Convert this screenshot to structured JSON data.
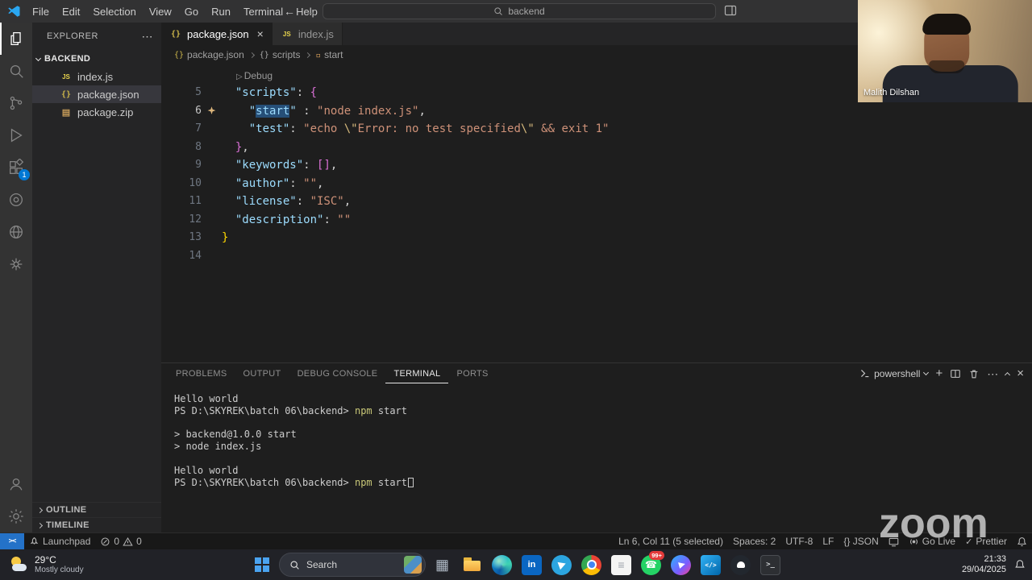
{
  "title_bar": {
    "menus": [
      "File",
      "Edit",
      "Selection",
      "View",
      "Go",
      "Run",
      "Terminal",
      "Help"
    ],
    "search_value": "backend"
  },
  "activity_bar": {
    "extensions_badge": "1"
  },
  "explorer": {
    "title": "EXPLORER",
    "folder": "BACKEND",
    "files": [
      {
        "name": "index.js",
        "icon": "js",
        "active": false
      },
      {
        "name": "package.json",
        "icon": "json",
        "active": true
      },
      {
        "name": "package.zip",
        "icon": "zip",
        "active": false
      }
    ],
    "bottom_sections": [
      "OUTLINE",
      "TIMELINE"
    ]
  },
  "editor": {
    "tabs": [
      {
        "label": "package.json",
        "icon": "json",
        "active": true
      },
      {
        "label": "index.js",
        "icon": "js",
        "active": false
      }
    ],
    "breadcrumb": [
      {
        "label": "package.json"
      },
      {
        "label": "scripts"
      },
      {
        "label": "start"
      }
    ],
    "codelens": "Debug",
    "lines": [
      {
        "num": "5",
        "tokens": [
          {
            "c": "p",
            "t": "  "
          },
          {
            "c": "k",
            "t": "\"scripts\""
          },
          {
            "c": "p",
            "t": ": "
          },
          {
            "c": "b2",
            "t": "{"
          }
        ]
      },
      {
        "num": "6",
        "active": true,
        "sparkle": true,
        "tokens": [
          {
            "c": "p",
            "t": "    "
          },
          {
            "c": "k",
            "t": "\""
          },
          {
            "c": "k sel",
            "t": "start"
          },
          {
            "c": "k",
            "t": "\""
          },
          {
            "c": "p",
            "t": " : "
          },
          {
            "c": "s",
            "t": "\"node index.js\""
          },
          {
            "c": "p",
            "t": ","
          }
        ]
      },
      {
        "num": "7",
        "tokens": [
          {
            "c": "p",
            "t": "    "
          },
          {
            "c": "k",
            "t": "\"test\""
          },
          {
            "c": "p",
            "t": ": "
          },
          {
            "c": "s",
            "t": "\"echo "
          },
          {
            "c": "e",
            "t": "\\\""
          },
          {
            "c": "s",
            "t": "Error: no test specified"
          },
          {
            "c": "e",
            "t": "\\\""
          },
          {
            "c": "s",
            "t": " && exit 1\""
          }
        ]
      },
      {
        "num": "8",
        "tokens": [
          {
            "c": "p",
            "t": "  "
          },
          {
            "c": "b2",
            "t": "}"
          },
          {
            "c": "p",
            "t": ","
          }
        ]
      },
      {
        "num": "9",
        "tokens": [
          {
            "c": "p",
            "t": "  "
          },
          {
            "c": "k",
            "t": "\"keywords\""
          },
          {
            "c": "p",
            "t": ": "
          },
          {
            "c": "b2",
            "t": "[]"
          },
          {
            "c": "p",
            "t": ","
          }
        ]
      },
      {
        "num": "10",
        "tokens": [
          {
            "c": "p",
            "t": "  "
          },
          {
            "c": "k",
            "t": "\"author\""
          },
          {
            "c": "p",
            "t": ": "
          },
          {
            "c": "s",
            "t": "\"\""
          },
          {
            "c": "p",
            "t": ","
          }
        ]
      },
      {
        "num": "11",
        "tokens": [
          {
            "c": "p",
            "t": "  "
          },
          {
            "c": "k",
            "t": "\"license\""
          },
          {
            "c": "p",
            "t": ": "
          },
          {
            "c": "s",
            "t": "\"ISC\""
          },
          {
            "c": "p",
            "t": ","
          }
        ]
      },
      {
        "num": "12",
        "tokens": [
          {
            "c": "p",
            "t": "  "
          },
          {
            "c": "k",
            "t": "\"description\""
          },
          {
            "c": "p",
            "t": ": "
          },
          {
            "c": "s",
            "t": "\"\""
          }
        ]
      },
      {
        "num": "13",
        "tokens": [
          {
            "c": "b1",
            "t": "}"
          }
        ]
      },
      {
        "num": "14",
        "tokens": []
      }
    ]
  },
  "panel": {
    "tabs": [
      "PROBLEMS",
      "OUTPUT",
      "DEBUG CONSOLE",
      "TERMINAL",
      "PORTS"
    ],
    "active_tab": "TERMINAL",
    "shell_label": "powershell",
    "terminal_lines": [
      [
        {
          "c": "d",
          "t": "Hello world"
        }
      ],
      [
        {
          "c": "d",
          "t": "PS D:\\SKYREK\\batch 06\\backend> "
        },
        {
          "c": "y",
          "t": "npm"
        },
        {
          "c": "d",
          "t": " start"
        }
      ],
      [],
      [
        {
          "c": "d",
          "t": "> backend@1.0.0 start"
        }
      ],
      [
        {
          "c": "d",
          "t": "> node index.js"
        }
      ],
      [],
      [
        {
          "c": "d",
          "t": "Hello world"
        }
      ],
      [
        {
          "c": "d",
          "t": "PS D:\\SKYREK\\batch 06\\backend> "
        },
        {
          "c": "y",
          "t": "npm"
        },
        {
          "c": "d",
          "t": " start"
        },
        {
          "c": "cursor",
          "t": ""
        }
      ]
    ]
  },
  "status_bar": {
    "launchpad": "Launchpad",
    "errors": "0",
    "warnings": "0",
    "line_col": "Ln 6, Col 11 (5 selected)",
    "spaces": "Spaces: 2",
    "encoding": "UTF-8",
    "eol": "LF",
    "language": "{} JSON",
    "go_live": "Go Live",
    "prettier": "Prettier"
  },
  "taskbar": {
    "weather_temp": "29°C",
    "weather_cond": "Mostly cloudy",
    "search_label": "Search",
    "apps": [
      {
        "name": "task-view"
      },
      {
        "name": "file-explorer"
      },
      {
        "name": "edge"
      },
      {
        "name": "linkedin"
      },
      {
        "name": "telegram"
      },
      {
        "name": "chrome"
      },
      {
        "name": "notes"
      },
      {
        "name": "whatsapp",
        "badge": "99+"
      },
      {
        "name": "messenger"
      },
      {
        "name": "vscode"
      },
      {
        "name": "github"
      },
      {
        "name": "terminal"
      }
    ],
    "time": "21:33",
    "date": "29/04/2025"
  },
  "webcam": {
    "name": "Malith Dilshan"
  },
  "watermark": "zoom"
}
